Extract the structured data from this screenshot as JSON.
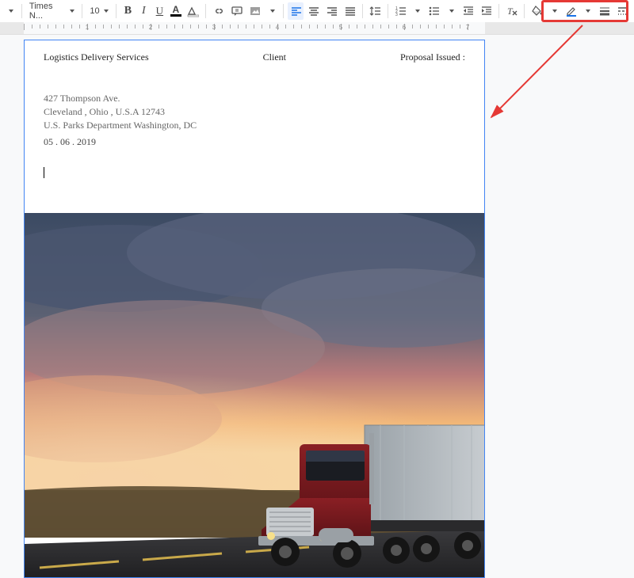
{
  "toolbar": {
    "font_name": "Times N...",
    "font_size": "10",
    "bold": "B",
    "italic": "I",
    "underline": "U",
    "text_color_letter": "A"
  },
  "ruler": {
    "numbers": [
      "1",
      "2",
      "3",
      "4",
      "5",
      "6",
      "7"
    ]
  },
  "document": {
    "header": {
      "left": "Logistics Delivery Services",
      "center": "Client",
      "right": "Proposal Issued :"
    },
    "address": {
      "line1": "427 Thompson Ave.",
      "line2": "Cleveland , Ohio , U.S.A 12743",
      "line3": "U.S. Parks Department Washington, DC"
    },
    "date": "05 . 06 . 2019"
  },
  "annotation": {
    "highlight_target": "border-tools-group"
  }
}
